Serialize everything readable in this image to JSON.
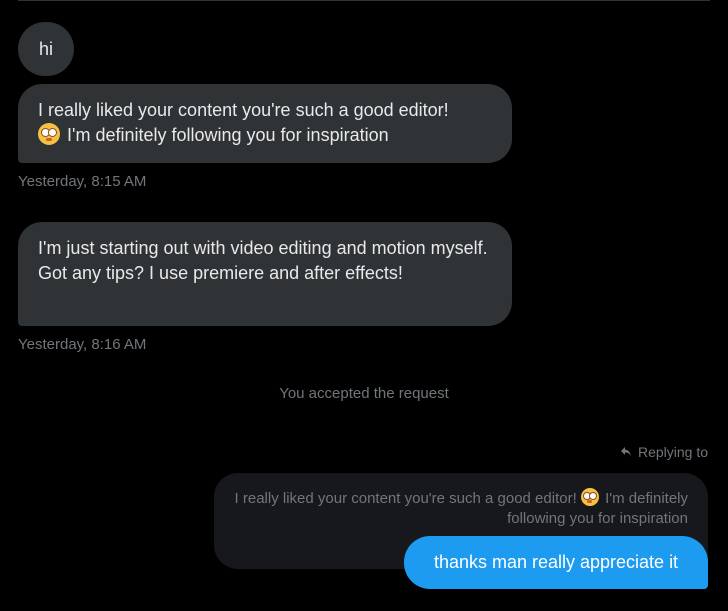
{
  "messages_in": [
    {
      "text": "hi"
    },
    {
      "text_line1": "I really liked your content you're such a good editor!",
      "emoji": "flushed-face-emoji",
      "text_line2": "I'm definitely following you for inspiration",
      "timestamp": "Yesterday, 8:15 AM"
    },
    {
      "text": "I'm just starting out with video editing and motion myself. Got any tips? I use premiere and after effects!",
      "timestamp": "Yesterday, 8:16 AM"
    }
  ],
  "system_message": "You accepted the request",
  "reply": {
    "replying_to_label": "Replying to",
    "reply_icon": "reply-arrow-icon",
    "quoted_part1": "I really liked your content you're such a good editor!",
    "quoted_emoji": "flushed-face-emoji",
    "quoted_part2": "I'm definitely following you for inspiration"
  },
  "message_out": {
    "text": "thanks man really appreciate it"
  },
  "colors": {
    "background": "#000000",
    "incoming_bubble": "#2f3336",
    "outgoing_bubble": "#1d9bf0",
    "quoted_bubble": "#16181c",
    "muted_text": "#71767b"
  }
}
